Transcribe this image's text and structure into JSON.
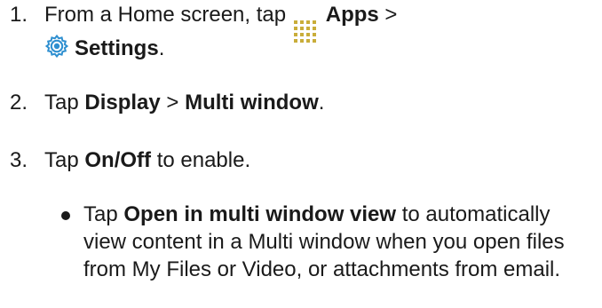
{
  "steps": [
    {
      "number": "1.",
      "line1": {
        "t1": "From a Home screen, tap ",
        "apps_icon": "apps-grid-icon",
        "b1": "Apps",
        "t2": " >"
      },
      "line2": {
        "settings_icon": "gear-icon",
        "b1": "Settings",
        "t1": "."
      }
    },
    {
      "number": "2.",
      "t1": "Tap ",
      "b1": "Display",
      "t2": " > ",
      "b2": "Multi window",
      "t3": "."
    },
    {
      "number": "3.",
      "t1": "Tap ",
      "b1": "On/Off",
      "t2": " to enable."
    }
  ],
  "bullet": {
    "t1": "Tap ",
    "b1": "Open in multi window view",
    "t2": " to automatically view content in a Multi window when you open files from My Files or Video, or attachments from email."
  },
  "colors": {
    "text": "#1a1a1a",
    "apps_icon": "#c9ad3a",
    "settings_icon": "#2e8fd0"
  }
}
